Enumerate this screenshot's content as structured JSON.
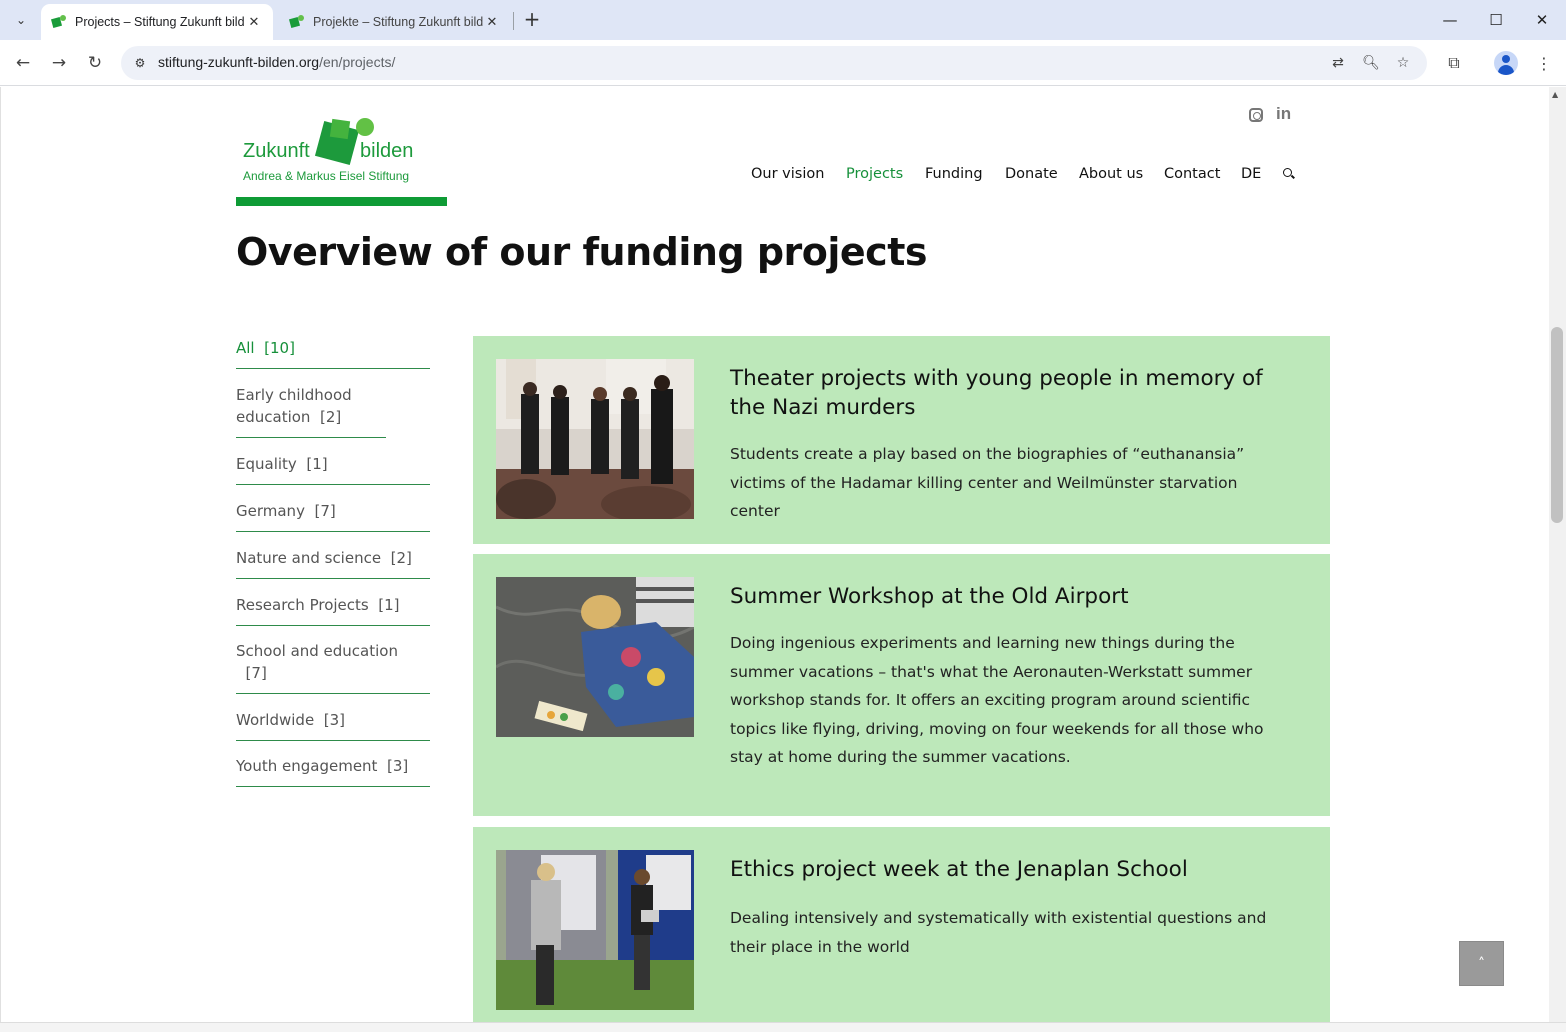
{
  "browser": {
    "tabs": [
      {
        "title": "Projects – Stiftung Zukunft bilden",
        "active": true
      },
      {
        "title": "Projekte – Stiftung Zukunft bilden",
        "active": false
      }
    ],
    "url_host": "stiftung-zukunft-bilden.org",
    "url_path": "/en/projects/"
  },
  "logo": {
    "word1": "Zukunft",
    "word2": "bilden",
    "subtitle": "Andrea & Markus Eisel Stiftung"
  },
  "nav": {
    "items": [
      "Our vision",
      "Projects",
      "Funding",
      "Donate",
      "About us",
      "Contact",
      "DE"
    ],
    "active": "Projects"
  },
  "page_title": "Overview of our funding projects",
  "filters": [
    {
      "label": "All",
      "count": "[10]",
      "active": true
    },
    {
      "label": "Early childhood education",
      "count": "[2]"
    },
    {
      "label": "Equality",
      "count": "[1]"
    },
    {
      "label": "Germany",
      "count": "[7]"
    },
    {
      "label": "Nature and science",
      "count": "[2]"
    },
    {
      "label": "Research Projects",
      "count": "[1]"
    },
    {
      "label": "School and education",
      "count": "[7]"
    },
    {
      "label": "Worldwide",
      "count": "[3]"
    },
    {
      "label": "Youth engagement",
      "count": "[3]"
    }
  ],
  "projects": [
    {
      "title": "Theater projects with young people in memory of the Nazi murders",
      "description": "Students create a play based on the biographies of “euthanansia” victims of the Hadamar killing center and Weilmünster starvation center"
    },
    {
      "title": "Summer Workshop at the Old Airport",
      "description": "Doing ingenious experiments and learning new things during the summer vacations – that's what the Aeronauten-Werkstatt summer workshop stands for. It offers an exciting program around scientific topics like flying, driving, moving on four weekends for all those who stay at home during the summer vacations."
    },
    {
      "title": "Ethics project week at the Jenaplan School",
      "description": "Dealing intensively and systematically with existential questions and their place in the world"
    }
  ],
  "colors": {
    "brand_green": "#16903a",
    "card_bg": "#bde8ba"
  }
}
